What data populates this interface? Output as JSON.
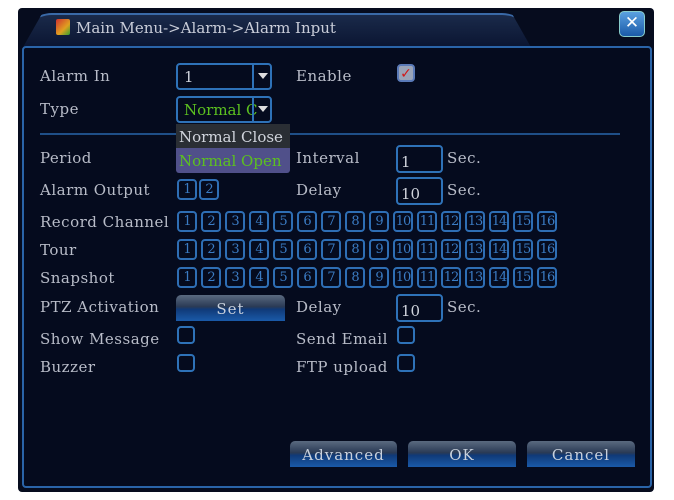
{
  "title": "Main Menu->Alarm->Alarm Input",
  "labels": {
    "alarm_in": "Alarm In",
    "type": "Type",
    "enable": "Enable",
    "period": "Period",
    "interval": "Interval",
    "alarm_output": "Alarm Output",
    "delay": "Delay",
    "record_channel": "Record Channel",
    "tour": "Tour",
    "snapshot": "Snapshot",
    "ptz_activation": "PTZ Activation",
    "delay2": "Delay",
    "show_message": "Show Message",
    "send_email": "Send Email",
    "buzzer": "Buzzer",
    "ftp_upload": "FTP upload",
    "sec": "Sec."
  },
  "values": {
    "alarm_in": "1",
    "type": "Normal C",
    "interval": "1",
    "delay": "10",
    "ptz_delay": "10",
    "enable": true
  },
  "type_options": [
    "Normal Close",
    "Normal Open"
  ],
  "alarm_outputs": [
    "1",
    "2"
  ],
  "channels": [
    "1",
    "2",
    "3",
    "4",
    "5",
    "6",
    "7",
    "8",
    "9",
    "10",
    "11",
    "12",
    "13",
    "14",
    "15",
    "16"
  ],
  "buttons": {
    "set": "Set",
    "advanced": "Advanced",
    "ok": "OK",
    "cancel": "Cancel"
  },
  "colors": {
    "background": "#050b1e",
    "accent": "#2e72b8",
    "selected_text": "#5cc020"
  }
}
